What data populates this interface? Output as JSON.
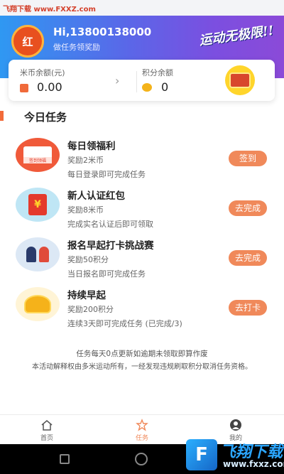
{
  "watermark_top": "飞翔下载 www.FXXZ.com",
  "header": {
    "avatar_text": "红",
    "greeting": "Hi,13800138000",
    "subtitle": "做任务领奖励",
    "slogan": "运动无极限!!"
  },
  "balance": {
    "rice_label": "米币余额(元)",
    "rice_value": "0.00",
    "points_label": "积分余额",
    "points_value": "0"
  },
  "section_title": "今日任务",
  "tasks": [
    {
      "title": "每日领福利",
      "reward": "奖励2米币",
      "desc": "每日登录即可完成任务",
      "button": "签到",
      "icon_text": "签到领福"
    },
    {
      "title": "新人认证红包",
      "reward": "奖励8米币",
      "desc": "完成实名认证后即可领取",
      "button": "去完成",
      "icon_text": "¥"
    },
    {
      "title": "报名早起打卡挑战赛",
      "reward": "奖励50积分",
      "desc": "当日报名即可完成任务",
      "button": "去完成"
    },
    {
      "title": "持续早起",
      "reward": "奖励200积分",
      "desc": "连续3天即可完成任务  (已完成/3)",
      "button": "去打卡"
    }
  ],
  "footnotes": {
    "line1": "任务每天0点更新如逾期未领取即算作废",
    "line2": "本活动解释权由多米运动所有，一经发现违规刷取积分取消任务资格。"
  },
  "tabs": [
    {
      "label": "首页"
    },
    {
      "label": "任务"
    },
    {
      "label": "我的"
    }
  ],
  "watermark_logo": {
    "title": "飞翔下载",
    "sub": "www.fxxz.com"
  },
  "colors": {
    "accent": "#f0895a",
    "header_start": "#2f98f2",
    "header_end": "#8b4ad8",
    "active_tab": "#f0895a"
  }
}
